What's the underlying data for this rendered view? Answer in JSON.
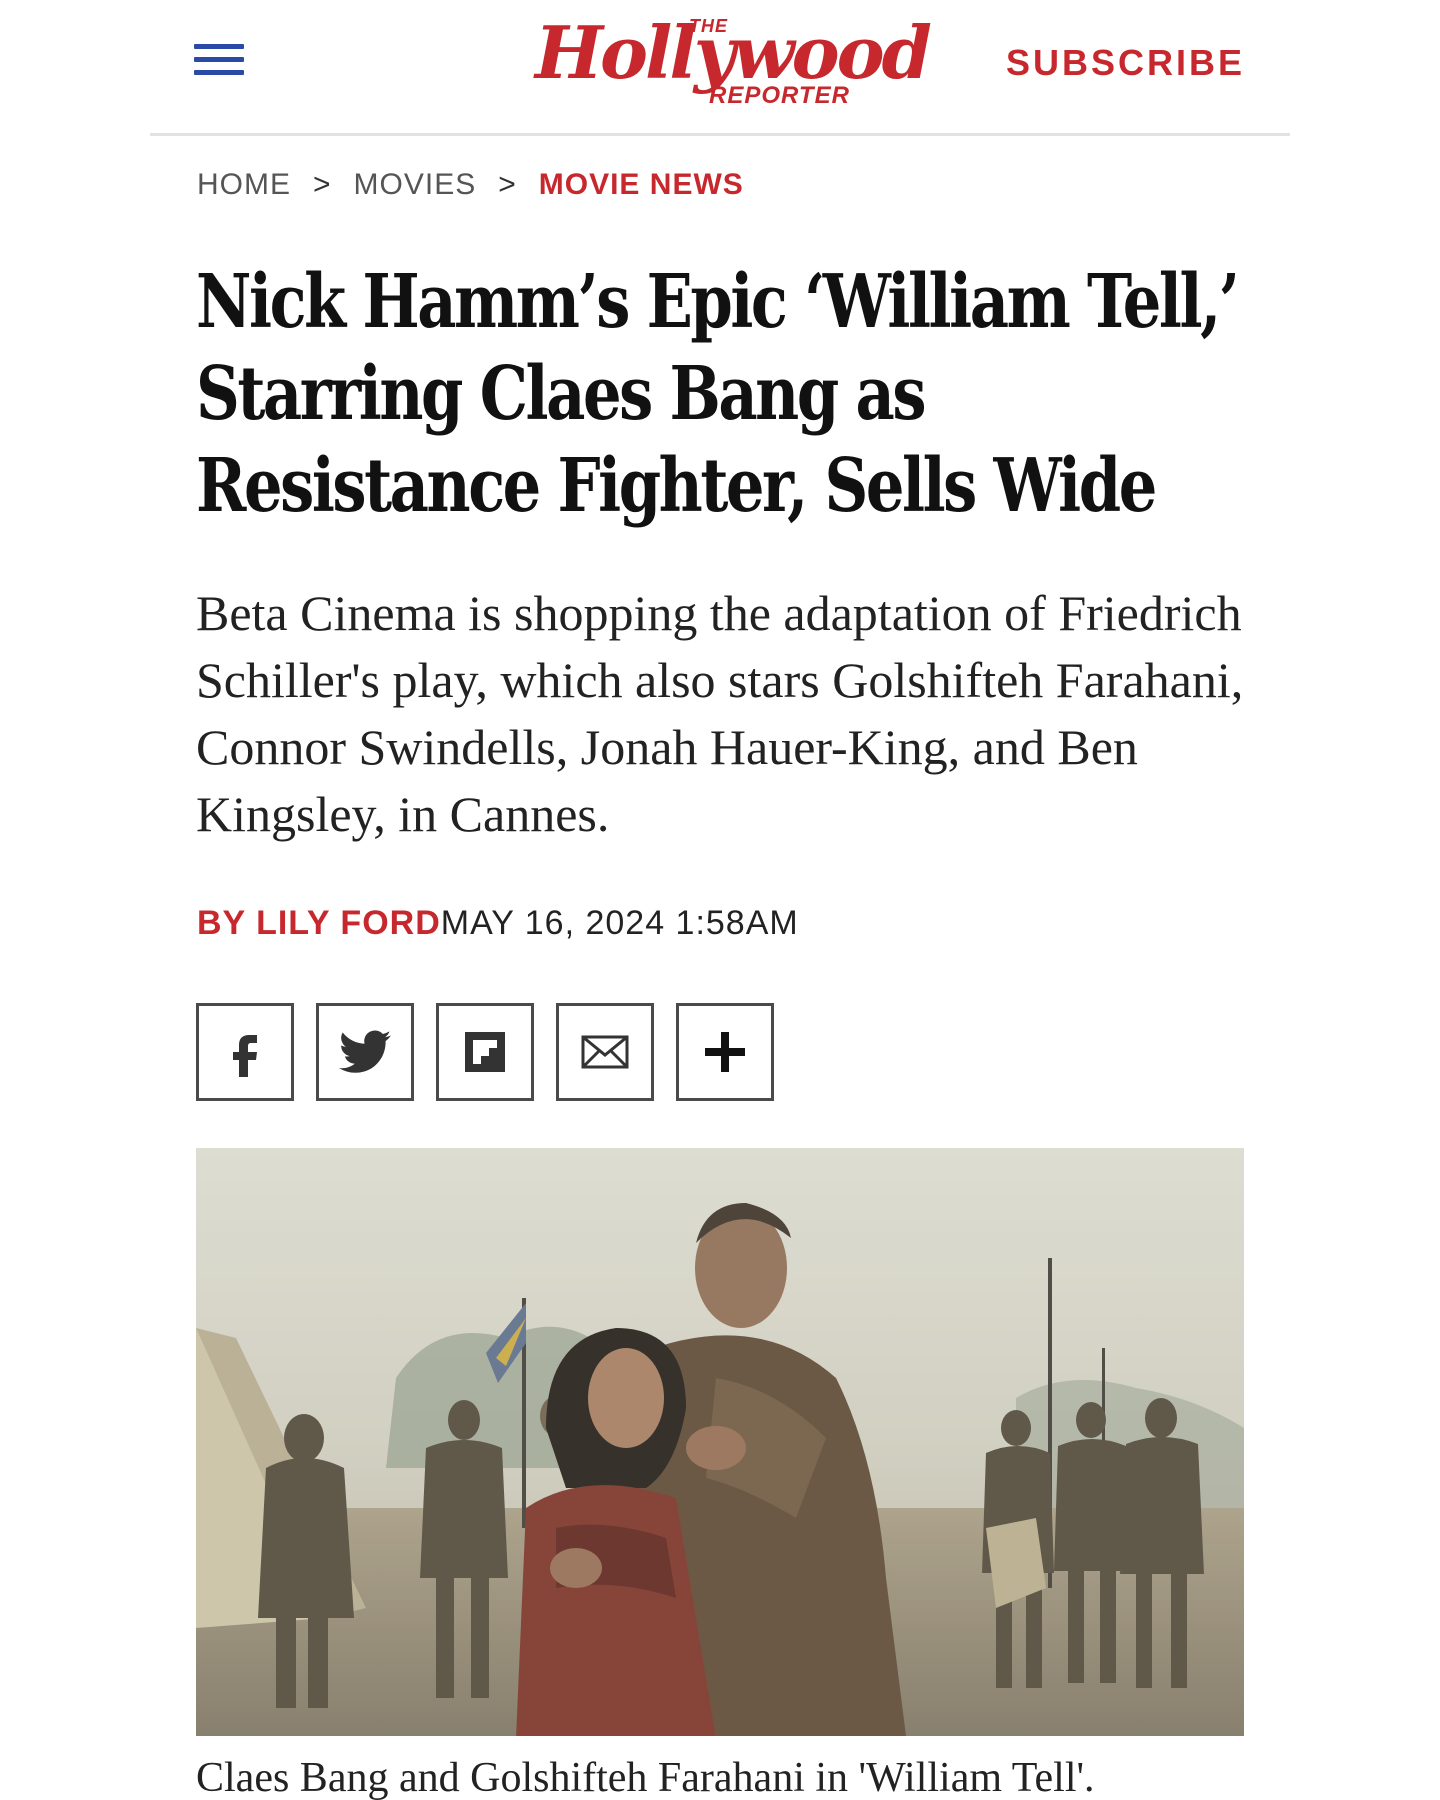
{
  "header": {
    "logo": {
      "the": "THE",
      "name": "Hollywood",
      "reporter": "REPORTER"
    },
    "subscribe_label": "SUBSCRIBE",
    "brand_color": "#c7282d",
    "menu_icon": "hamburger-menu-icon"
  },
  "breadcrumb": {
    "items": [
      "HOME",
      "MOVIES",
      "MOVIE NEWS"
    ],
    "separator": ">"
  },
  "article": {
    "headline": "Nick Hamm’s Epic ‘William Tell,’ Starring Claes Bang as Resistance Fighter, Sells Wide",
    "dek": "Beta Cinema is shopping the adaptation of Friedrich Schiller's play, which also stars Golshifteh Farahani, Connor Swindells, Jonah Hauer-King, and Ben Kingsley, in Cannes.",
    "byline": "BY LILY FORD",
    "date": "MAY 16, 2024 1:58AM",
    "share_buttons": [
      "facebook-icon",
      "twitter-icon",
      "flipboard-icon",
      "email-icon",
      "plus-icon"
    ],
    "image_caption": "Claes Bang and Golshifteh Farahani in 'William Tell'."
  }
}
